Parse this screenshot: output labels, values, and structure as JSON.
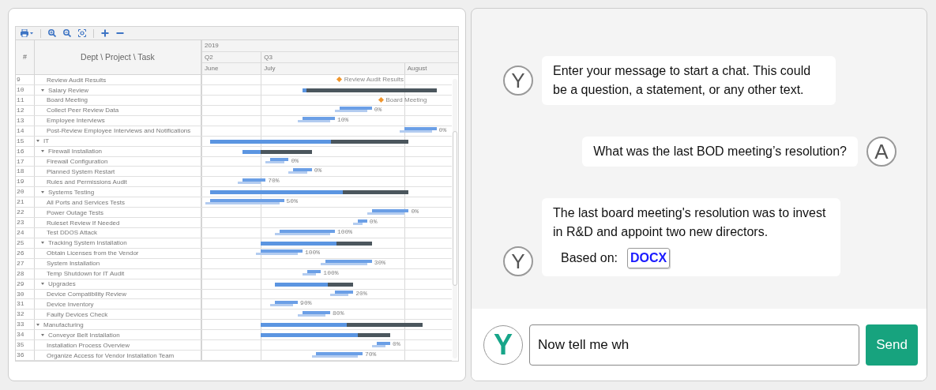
{
  "gantt": {
    "header": {
      "number": "#",
      "task": "Dept \\ Project \\ Task"
    },
    "timeline": {
      "years": [
        "2019"
      ],
      "quarters": [
        "Q2",
        "Q3"
      ],
      "months": [
        "June",
        "July",
        "August"
      ]
    },
    "rows": [
      {
        "number": "9",
        "name": "Review Audit Results",
        "kind": "task",
        "bar": {
          "kind": "milestone",
          "label": "Review Audit Results"
        }
      },
      {
        "number": "10",
        "name": "Salary Review",
        "kind": "project",
        "expanded": true,
        "bar": {
          "kind": "summary",
          "level": 0.03
        },
        "children": [
          {
            "number": "11",
            "name": "Board Meeting",
            "kind": "task",
            "bar": {
              "kind": "milestone",
              "label": "Board Meeting"
            }
          },
          {
            "number": "12",
            "name": "Collect Peer Review Data",
            "kind": "task",
            "bar": {
              "kind": "task",
              "progress": "0%"
            }
          },
          {
            "number": "13",
            "name": "Employee Interviews",
            "kind": "task",
            "bar": {
              "kind": "task",
              "progress": "10%"
            }
          },
          {
            "number": "14",
            "name": "Post-Review Employee Interviews and Notifications",
            "kind": "task",
            "bar": {
              "kind": "task",
              "progress": "0%"
            }
          }
        ]
      },
      {
        "number": "15",
        "name": "IT",
        "kind": "dept",
        "expanded": true,
        "bar": {
          "kind": "summary",
          "level": 0.61
        },
        "children": [
          {
            "number": "16",
            "name": "Firewall Installation",
            "kind": "project",
            "expanded": true,
            "bar": {
              "kind": "summary",
              "level": 0.26
            },
            "children": [
              {
                "number": "17",
                "name": "Firewall Configuration",
                "kind": "task",
                "bar": {
                  "kind": "task",
                  "progress": "0%"
                }
              },
              {
                "number": "18",
                "name": "Planned System Restart",
                "kind": "task",
                "bar": {
                  "kind": "task",
                  "progress": "0%"
                }
              },
              {
                "number": "19",
                "name": "Rules and Permissions Audit",
                "kind": "task",
                "bar": {
                  "kind": "task",
                  "progress": "70%"
                }
              }
            ]
          },
          {
            "number": "20",
            "name": "Systems Testing",
            "kind": "project",
            "expanded": true,
            "bar": {
              "kind": "summary",
              "level": 0.67
            },
            "children": [
              {
                "number": "21",
                "name": "All Ports and Services Tests",
                "kind": "task",
                "bar": {
                  "kind": "task",
                  "progress": "50%"
                }
              },
              {
                "number": "22",
                "name": "Power Outage Tests",
                "kind": "task",
                "bar": {
                  "kind": "task",
                  "progress": "0%"
                }
              },
              {
                "number": "23",
                "name": "Ruleset Review If Needed",
                "kind": "task",
                "bar": {
                  "kind": "task",
                  "progress": "0%"
                }
              },
              {
                "number": "24",
                "name": "Test DDOS Attack",
                "kind": "task",
                "bar": {
                  "kind": "task",
                  "progress": "100%"
                }
              }
            ]
          },
          {
            "number": "25",
            "name": "Tracking System Installation",
            "kind": "project",
            "expanded": true,
            "bar": {
              "kind": "summary",
              "level": 0.68
            },
            "children": [
              {
                "number": "26",
                "name": "Obtain Licenses from the Vendor",
                "kind": "task",
                "bar": {
                  "kind": "task",
                  "progress": "100%"
                }
              },
              {
                "number": "27",
                "name": "System Installation",
                "kind": "task",
                "bar": {
                  "kind": "task",
                  "progress": "30%"
                }
              },
              {
                "number": "28",
                "name": "Temp Shutdown for IT Audit",
                "kind": "task",
                "bar": {
                  "kind": "task",
                  "progress": "100%"
                }
              }
            ]
          },
          {
            "number": "29",
            "name": "Upgrades",
            "kind": "project",
            "expanded": true,
            "bar": {
              "kind": "summary",
              "level": 0.68
            },
            "children": [
              {
                "number": "30",
                "name": "Device Compatibility Review",
                "kind": "task",
                "bar": {
                  "kind": "task",
                  "progress": "20%"
                }
              },
              {
                "number": "31",
                "name": "Device Inventory",
                "kind": "task",
                "bar": {
                  "kind": "task",
                  "progress": "90%"
                }
              },
              {
                "number": "32",
                "name": "Faulty Devices Check",
                "kind": "task",
                "bar": {
                  "kind": "task",
                  "progress": "80%"
                }
              }
            ]
          }
        ]
      },
      {
        "number": "33",
        "name": "Manufacturing",
        "kind": "dept",
        "expanded": true,
        "bar": {
          "kind": "summary",
          "level": 0.53
        },
        "children": [
          {
            "number": "34",
            "name": "Conveyor Belt Installation",
            "kind": "project",
            "expanded": true,
            "bar": {
              "kind": "summary",
              "level": 0.75
            },
            "children": [
              {
                "number": "35",
                "name": "Installation Process Overview",
                "kind": "task",
                "bar": {
                  "kind": "task",
                  "progress": "0%"
                }
              },
              {
                "number": "36",
                "name": "Organize Access for Vendor Installation Team",
                "kind": "task",
                "bar": {
                  "kind": "task",
                  "progress": "70%"
                }
              }
            ]
          }
        ]
      }
    ]
  },
  "chat": {
    "messages": [
      {
        "kind": "received",
        "avatar": "Y",
        "text": "Enter your message to start a chat. This could be a question, a statement, or any other text."
      },
      {
        "kind": "sent",
        "avatar": "A",
        "text": "What was the last BOD meeting’s resolution?"
      },
      {
        "kind": "received",
        "avatar": "Y",
        "text": "The last board meeting's resolution was to invest in R&D and appoint two new directors.",
        "source_label": "Based on:",
        "attachment": "DOCX"
      }
    ],
    "composer": {
      "avatar": "Y",
      "value": "Now tell me wh",
      "send": "Send"
    }
  }
}
